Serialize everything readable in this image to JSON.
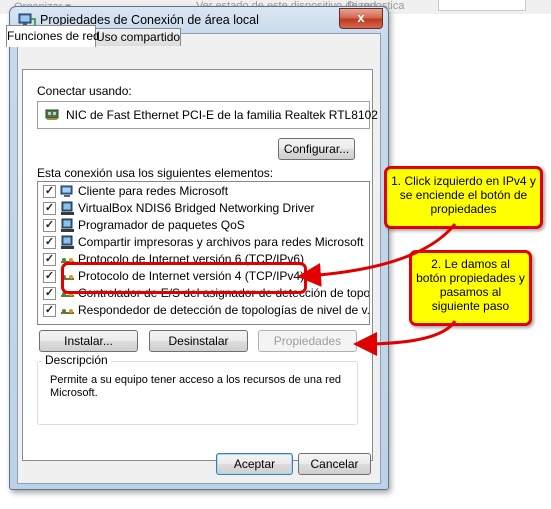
{
  "background": {
    "left_text": "Organizar ▾",
    "mid_text": "Ver estado de este dispositivo de red",
    "right_text": "Diagnostica"
  },
  "window": {
    "title": "Propiedades de Conexión de área local",
    "close_label": "x"
  },
  "tabs": [
    {
      "label": "Funciones de red",
      "active": true
    },
    {
      "label": "Uso compartido",
      "active": false
    }
  ],
  "connect_using": {
    "label": "Conectar usando:",
    "adapter": "NIC de Fast Ethernet PCI-E de la familia Realtek RTL8102",
    "configure_button": "Configurar..."
  },
  "items_label": "Esta conexión usa los siguientes elementos:",
  "items": [
    {
      "label": "Cliente para redes Microsoft",
      "checked": true,
      "icon": "network-client-icon",
      "selected": false
    },
    {
      "label": "VirtualBox NDIS6 Bridged Networking Driver",
      "checked": true,
      "icon": "network-driver-icon",
      "selected": false
    },
    {
      "label": "Programador de paquetes QoS",
      "checked": true,
      "icon": "network-service-icon",
      "selected": false
    },
    {
      "label": "Compartir impresoras y archivos para redes Microsoft",
      "checked": true,
      "icon": "network-service-icon",
      "selected": false
    },
    {
      "label": "Protocolo de Internet versión 6 (TCP/IPv6)",
      "checked": true,
      "icon": "protocol-icon",
      "selected": false
    },
    {
      "label": "Protocolo de Internet versión 4 (TCP/IPv4)",
      "checked": true,
      "icon": "protocol-icon",
      "selected": true
    },
    {
      "label": "Controlador de E/S del asignador de detección de topol...",
      "checked": true,
      "icon": "protocol-icon",
      "selected": false
    },
    {
      "label": "Respondedor de detección de topologías de nivel de v...",
      "checked": true,
      "icon": "protocol-icon",
      "selected": false
    }
  ],
  "buttons": {
    "install": "Instalar...",
    "uninstall": "Desinstalar",
    "properties": "Propiedades",
    "accept": "Aceptar",
    "cancel": "Cancelar"
  },
  "description": {
    "title": "Descripción",
    "text": "Permite a su equipo tener acceso a los recursos de una red Microsoft."
  },
  "callouts": [
    {
      "text": "1. Click izquierdo en IPv4 y se enciende el botón de propiedades"
    },
    {
      "text": "2. Le damos al botón propiedades y pasamos al siguiente paso"
    }
  ],
  "colors": {
    "callout_fill": "#ffff00",
    "callout_border": "#e00000",
    "window_frame": "#c7d9ec"
  }
}
